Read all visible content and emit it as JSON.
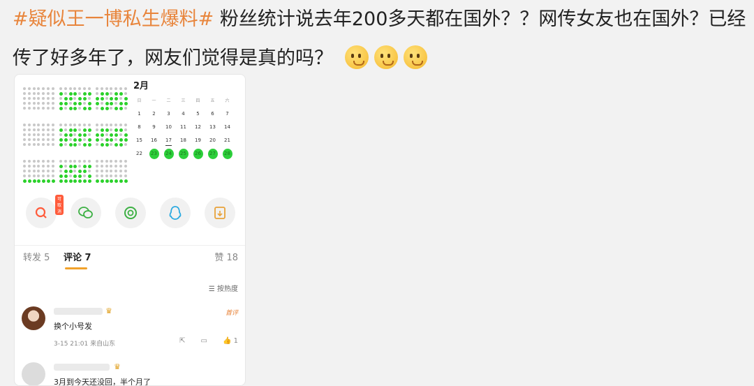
{
  "post": {
    "hashtag": "#疑似王一博私生爆料#",
    "line1_text": " 粉丝统计说去年200多天都在国外？？网传女友也在国外？已经",
    "line2_text": "传了好多年了，网友们觉得是真的吗？",
    "emojis": [
      "thinking-emoji",
      "thinking-emoji",
      "thinking-emoji"
    ]
  },
  "calendar": {
    "month": "2月",
    "weekdays": [
      "日",
      "一",
      "二",
      "三",
      "四",
      "五",
      "六"
    ],
    "weeks": [
      [
        "1",
        "2",
        "3",
        "4",
        "5",
        "6",
        "7"
      ],
      [
        "8",
        "9",
        "10",
        "11",
        "12",
        "13",
        "14"
      ],
      [
        "15",
        "16",
        "17",
        "18",
        "19",
        "20",
        "21"
      ],
      [
        "22",
        "23",
        "24",
        "25",
        "26",
        "27",
        "28"
      ]
    ],
    "highlighted_days": [
      "23",
      "24",
      "25",
      "26",
      "27",
      "28"
    ],
    "underlined_day": "17",
    "highlight_color": "#2ccf3a"
  },
  "share": {
    "badge": "可取消",
    "buttons": [
      "search-share-icon",
      "wechat-icon",
      "moments-icon",
      "qq-icon",
      "save-image-icon"
    ]
  },
  "tabs": {
    "repost": "转发 5",
    "comments": "评论 7",
    "likes": "赞 18"
  },
  "sort_label": "☰ 按热度",
  "comments": [
    {
      "text": "换个小号发",
      "tag": "首评",
      "meta": "3-15 21:01  来自山东",
      "likes": "1"
    },
    {
      "text": "3月到今天还没回，半个月了"
    }
  ],
  "colors": {
    "accent": "#e8853c",
    "green": "#2bd12b",
    "tab_underline": "#f1a22b"
  }
}
